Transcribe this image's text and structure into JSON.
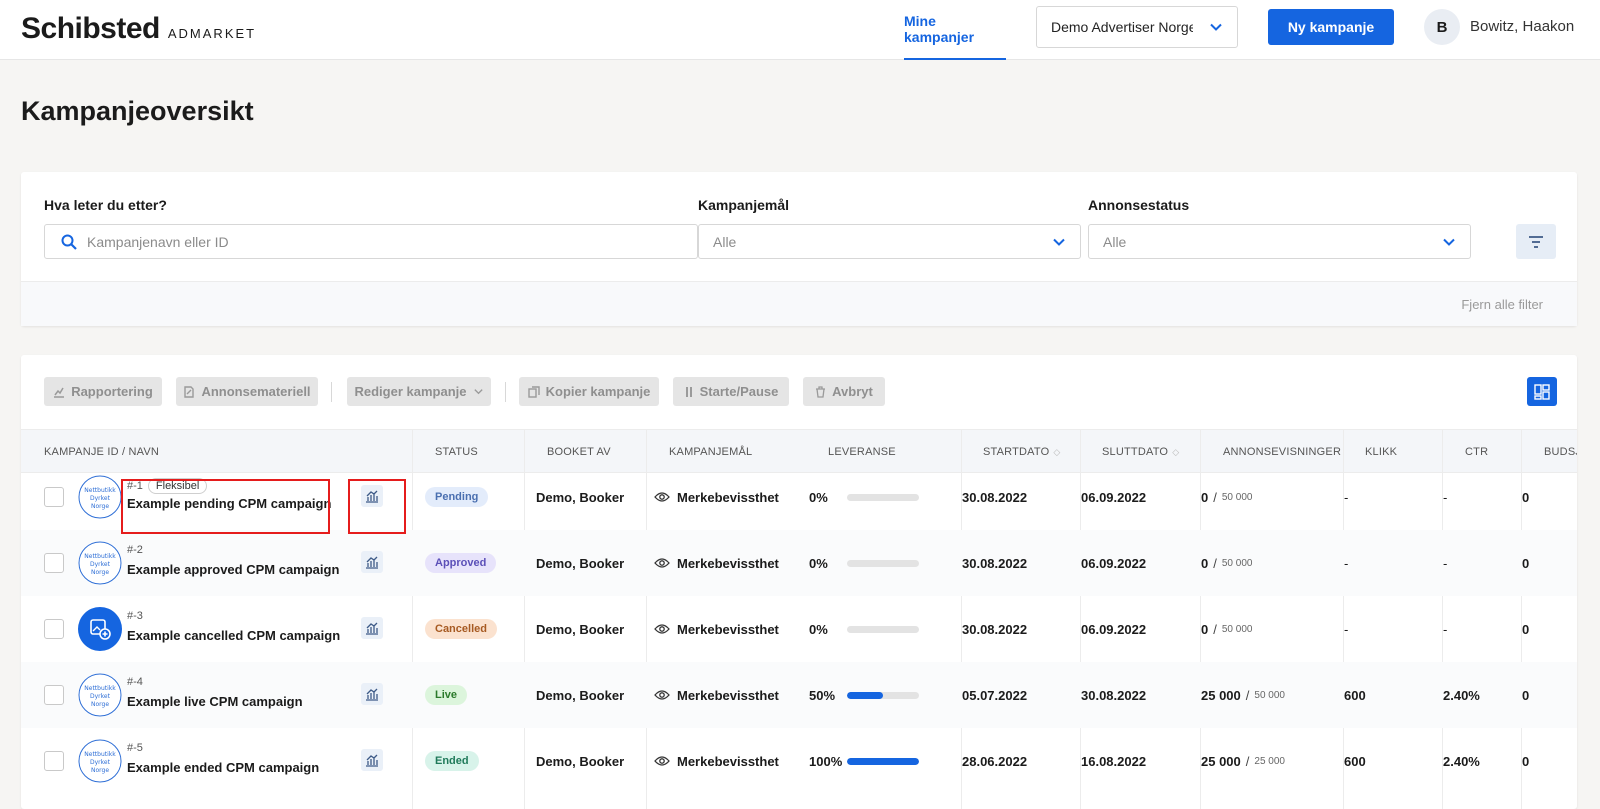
{
  "header": {
    "logo_main": "Schibsted",
    "logo_sub": "ADMARKET",
    "nav_active": "Mine kampanjer",
    "advertiser": "Demo Advertiser Norge",
    "new_campaign": "Ny kampanje",
    "avatar_initial": "B",
    "user_name": "Bowitz, Haakon"
  },
  "page_title": "Kampanjeoversikt",
  "filters": {
    "search_label": "Hva leter du etter?",
    "search_placeholder": "Kampanjenavn eller ID",
    "goal_label": "Kampanjemål",
    "goal_value": "Alle",
    "status_label": "Annonsestatus",
    "status_value": "Alle",
    "clear_all": "Fjern alle filter"
  },
  "toolbar": {
    "reporting": "Rapportering",
    "ad_material": "Annonsemateriell",
    "edit_campaign": "Rediger kampanje",
    "copy_campaign": "Kopier kampanje",
    "start_pause": "Starte/Pause",
    "cancel": "Avbryt"
  },
  "columns": {
    "id_name": "KAMPANJE ID / NAVN",
    "status": "STATUS",
    "booked_by": "BOOKET AV",
    "goal": "KAMPANJEMÅL",
    "delivery": "LEVERANSE",
    "start": "STARTDATO",
    "end": "SLUTTDATO",
    "impressions": "ANNONSEVISNINGER",
    "clicks": "KLIKK",
    "ctr": "CTR",
    "budget": "BUDSJE"
  },
  "rows": [
    {
      "id": "#-1",
      "badge": "Fleksibel",
      "name": "Example pending CPM campaign",
      "status": "Pending",
      "booked_by": "Demo, Booker",
      "goal": "Merkebevissthet",
      "delivery_pct": "0%",
      "delivery": 0,
      "start": "30.08.2022",
      "end": "06.09.2022",
      "imp": "0",
      "imp_total": "50 000",
      "clicks": "-",
      "ctr": "-",
      "budget": "0"
    },
    {
      "id": "#-2",
      "badge": "",
      "name": "Example approved CPM campaign",
      "status": "Approved",
      "booked_by": "Demo, Booker",
      "goal": "Merkebevissthet",
      "delivery_pct": "0%",
      "delivery": 0,
      "start": "30.08.2022",
      "end": "06.09.2022",
      "imp": "0",
      "imp_total": "50 000",
      "clicks": "-",
      "ctr": "-",
      "budget": "0"
    },
    {
      "id": "#-3",
      "badge": "",
      "name": "Example cancelled CPM campaign",
      "status": "Cancelled",
      "booked_by": "Demo, Booker",
      "goal": "Merkebevissthet",
      "delivery_pct": "0%",
      "delivery": 0,
      "start": "30.08.2022",
      "end": "06.09.2022",
      "imp": "0",
      "imp_total": "50 000",
      "clicks": "-",
      "ctr": "-",
      "budget": "0"
    },
    {
      "id": "#-4",
      "badge": "",
      "name": "Example live CPM campaign",
      "status": "Live",
      "booked_by": "Demo, Booker",
      "goal": "Merkebevissthet",
      "delivery_pct": "50%",
      "delivery": 0.5,
      "start": "05.07.2022",
      "end": "30.08.2022",
      "imp": "25 000",
      "imp_total": "50 000",
      "clicks": "600",
      "ctr": "2.40%",
      "budget": "0"
    },
    {
      "id": "#-5",
      "badge": "",
      "name": "Example ended CPM campaign",
      "status": "Ended",
      "booked_by": "Demo, Booker",
      "goal": "Merkebevissthet",
      "delivery_pct": "100%",
      "delivery": 1,
      "start": "28.06.2022",
      "end": "16.08.2022",
      "imp": "25 000",
      "imp_total": "25 000",
      "clicks": "600",
      "ctr": "2.40%",
      "budget": "0"
    }
  ],
  "colors": {
    "accent": "#1565e0",
    "highlight": "#e51c1c"
  }
}
